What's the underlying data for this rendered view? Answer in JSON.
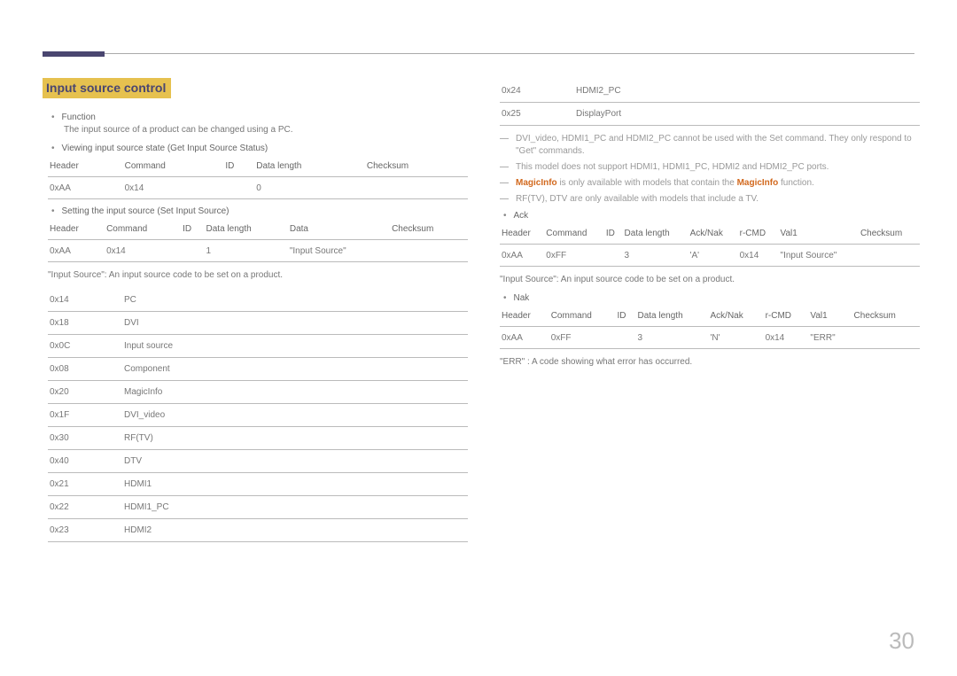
{
  "page_number": "30",
  "title": "Input source control",
  "left": {
    "function_label": "Function",
    "function_text": "The input source of a product can be changed using a PC.",
    "viewing_label": "Viewing input source state (Get Input Source Status)",
    "t1_headers": [
      "Header",
      "Command",
      "ID",
      "Data length",
      "Checksum"
    ],
    "t1_row": [
      "0xAA",
      "0x14",
      "",
      "0",
      ""
    ],
    "setting_label": "Setting the input source (Set Input Source)",
    "t2_headers": [
      "Header",
      "Command",
      "ID",
      "Data length",
      "Data",
      "Checksum"
    ],
    "t2_row": [
      "0xAA",
      "0x14",
      "",
      "1",
      "\"Input Source\"",
      ""
    ],
    "input_source_note": "\"Input Source\": An input source code to be set on a product.",
    "codes": [
      [
        "0x14",
        "PC"
      ],
      [
        "0x18",
        "DVI"
      ],
      [
        "0x0C",
        "Input source"
      ],
      [
        "0x08",
        "Component"
      ],
      [
        "0x20",
        "MagicInfo"
      ],
      [
        "0x1F",
        "DVI_video"
      ],
      [
        "0x30",
        "RF(TV)"
      ],
      [
        "0x40",
        "DTV"
      ],
      [
        "0x21",
        "HDMI1"
      ],
      [
        "0x22",
        "HDMI1_PC"
      ],
      [
        "0x23",
        "HDMI2"
      ]
    ]
  },
  "right": {
    "codes": [
      [
        "0x24",
        "HDMI2_PC"
      ],
      [
        "0x25",
        "DisplayPort"
      ]
    ],
    "dash1_a": "DVI_video, HDMI1_PC and HDMI2_PC cannot be used with the Set command. They only respond to \"Get\" commands.",
    "dash2": "This model does not support HDMI1, HDMI1_PC, HDMI2 and HDMI2_PC ports.",
    "dash3_a": "MagicInfo",
    "dash3_b": " is only available with models that contain the ",
    "dash3_c": "MagicInfo",
    "dash3_d": " function.",
    "dash4": "RF(TV), DTV are only available with models that include a TV.",
    "ack_label": "Ack",
    "ack_headers": [
      "Header",
      "Command",
      "ID",
      "Data length",
      "Ack/Nak",
      "r-CMD",
      "Val1",
      "Checksum"
    ],
    "ack_row": [
      "0xAA",
      "0xFF",
      "",
      "3",
      "'A'",
      "0x14",
      "\"Input Source\"",
      ""
    ],
    "ack_note": "\"Input Source\": An input source code to be set on a product.",
    "nak_label": "Nak",
    "nak_headers": [
      "Header",
      "Command",
      "ID",
      "Data length",
      "Ack/Nak",
      "r-CMD",
      "Val1",
      "Checksum"
    ],
    "nak_row": [
      "0xAA",
      "0xFF",
      "",
      "3",
      "'N'",
      "0x14",
      "\"ERR\"",
      ""
    ],
    "err_note": "\"ERR\" : A code showing what error has occurred."
  }
}
